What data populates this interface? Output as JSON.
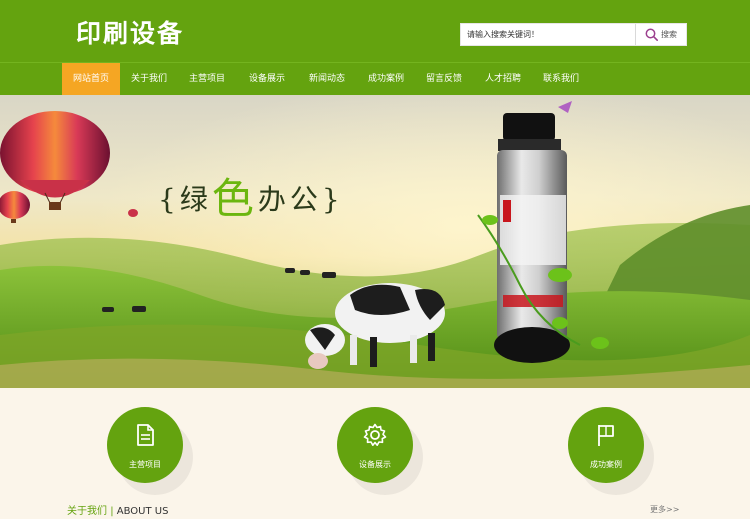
{
  "header": {
    "logo": "印刷设备",
    "search_placeholder": "请输入搜索关键词！",
    "search_button": "搜索"
  },
  "nav": {
    "items": [
      {
        "label": "网站首页",
        "active": true
      },
      {
        "label": "关于我们"
      },
      {
        "label": "主营项目"
      },
      {
        "label": "设备展示"
      },
      {
        "label": "新闻动态"
      },
      {
        "label": "成功案例"
      },
      {
        "label": "留言反馈"
      },
      {
        "label": "人才招聘"
      },
      {
        "label": "联系我们"
      }
    ]
  },
  "banner": {
    "title_left": "{绿",
    "title_accent": "色",
    "title_right": "办公}"
  },
  "features": [
    {
      "label": "主营项目",
      "icon": "document-icon"
    },
    {
      "label": "设备展示",
      "icon": "gear-icon"
    },
    {
      "label": "成功案例",
      "icon": "flag-icon"
    }
  ],
  "about": {
    "title_cn": "关于我们",
    "separator": "|",
    "title_en": "ABOUT US",
    "more": "更多>>"
  },
  "colors": {
    "brand_green": "#64a30f",
    "active_orange": "#f5a623",
    "page_bg": "#fbf5ea"
  }
}
